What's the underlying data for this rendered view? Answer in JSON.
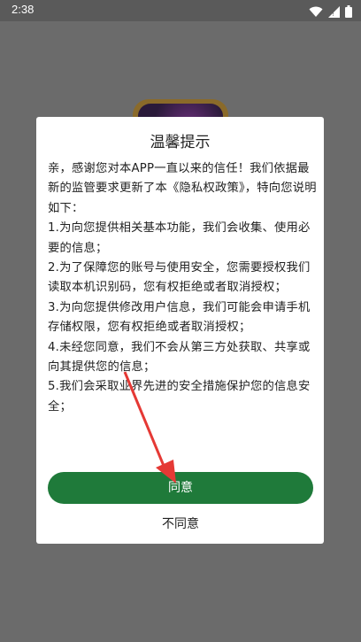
{
  "status_bar": {
    "time": "2:38"
  },
  "dialog": {
    "title": "温馨提示",
    "body": [
      "亲，感谢您对本APP一直以来的信任！我们依据最新的监管要求更新了本《隐私权政策》，特向您说明如下：",
      "1.为向您提供相关基本功能，我们会收集、使用必要的信息；",
      "2.为了保障您的账号与使用安全，您需要授权我们读取本机识别码，您有权拒绝或者取消授权；",
      "3.为向您提供修改用户信息，我们可能会申请手机存储权限，您有权拒绝或者取消授权；",
      "4.未经您同意，我们不会从第三方处获取、共享或向其提供您的信息；",
      "5.我们会采取业界先进的安全措施保护您的信息安全；"
    ],
    "agree_label": "同意",
    "disagree_label": "不同意"
  },
  "colors": {
    "overlay": "#6b6b6b",
    "agree_button": "#1f7a3a",
    "annotation_arrow": "#e53935"
  },
  "icons": [
    "wifi-icon",
    "cellular-signal-icon",
    "battery-icon",
    "annotation-arrow-icon"
  ]
}
